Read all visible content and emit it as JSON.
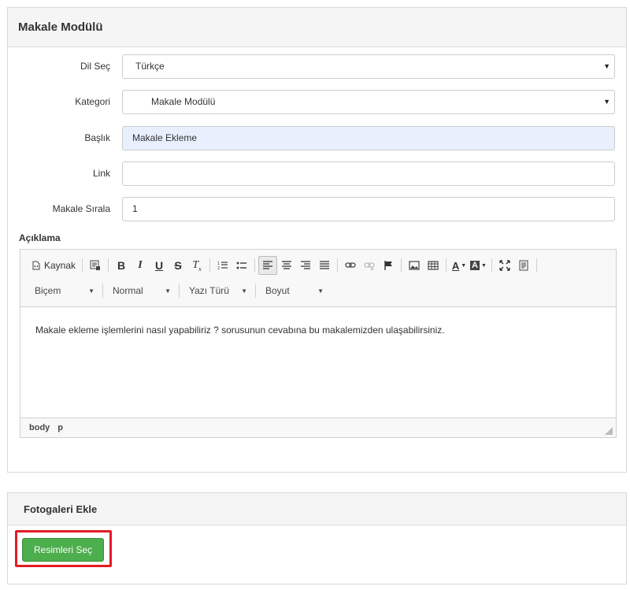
{
  "panel1": {
    "title": "Makale Modülü"
  },
  "form": {
    "language": {
      "label": "Dil Seç",
      "value": "Türkçe"
    },
    "category": {
      "label": "Kategori",
      "value": "Makale Modülü"
    },
    "title": {
      "label": "Başlık",
      "value": "Makale Ekleme"
    },
    "link": {
      "label": "Link",
      "value": ""
    },
    "order": {
      "label": "Makale Sırala",
      "value": "1"
    },
    "description_label": "Açıklama"
  },
  "editor": {
    "source_label": "Kaynak",
    "combos": {
      "format": "Biçem",
      "style": "Normal",
      "font": "Yazı Türü",
      "size": "Boyut"
    },
    "content": "Makale ekleme işlemlerini nasıl yapabiliriz ? sorusunun cevabına bu makalemizden ulaşabilirsiniz.",
    "path": [
      "body",
      "p"
    ]
  },
  "panel2": {
    "title": "Fotogaleri Ekle",
    "button_label": "Resimleri Seç"
  },
  "colors": {
    "accent_green": "#4cae4c",
    "highlight_red": "#e31b23",
    "autofill_bg": "#e8f0fe"
  }
}
